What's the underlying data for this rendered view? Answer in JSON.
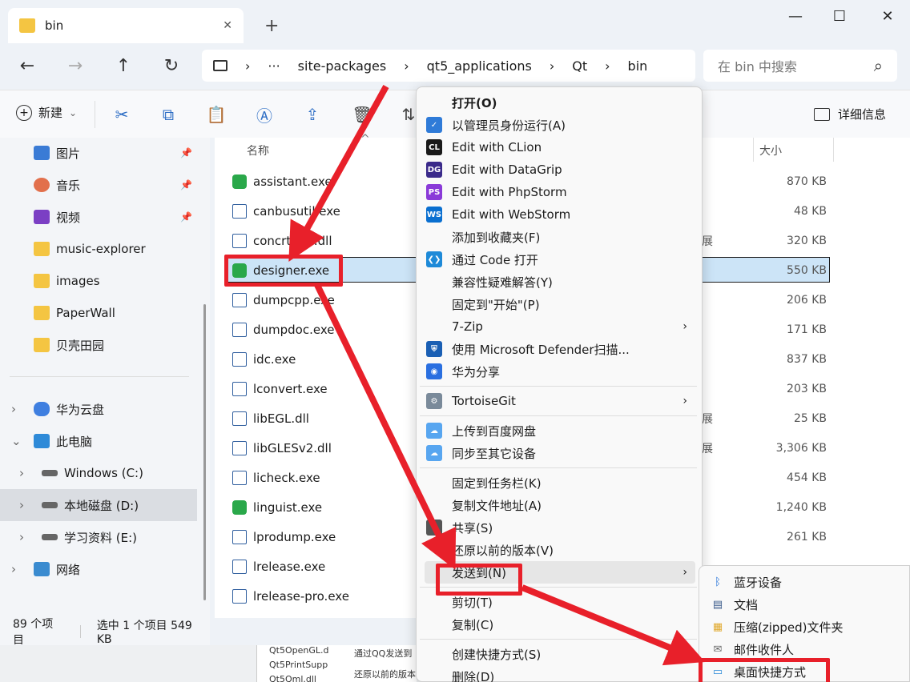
{
  "tab": {
    "title": "bin",
    "close": "✕",
    "new": "+"
  },
  "window": {
    "min": "—",
    "max": "☐",
    "close": "✕"
  },
  "nav_buttons": {
    "back": "←",
    "forward": "→",
    "up": "↑",
    "refresh": "↻"
  },
  "address": {
    "more": "···",
    "sep": "›",
    "crumbs": [
      "site-packages",
      "qt5_applications",
      "Qt",
      "bin"
    ]
  },
  "search": {
    "placeholder": "在 bin 中搜索",
    "icon": "⌕"
  },
  "toolbar": {
    "new_label": "新建",
    "new_arrow": "⌄",
    "details_label": "详细信息"
  },
  "sidebar": {
    "quick": [
      {
        "label": "图片",
        "icon": "pictures-icon",
        "pinned": true
      },
      {
        "label": "音乐",
        "icon": "music-icon",
        "pinned": true
      },
      {
        "label": "视频",
        "icon": "video-icon",
        "pinned": true
      },
      {
        "label": "music-explorer",
        "icon": "folder-icon"
      },
      {
        "label": "images",
        "icon": "folder-icon"
      },
      {
        "label": "PaperWall",
        "icon": "folder-icon"
      },
      {
        "label": "贝壳田园",
        "icon": "folder-icon"
      }
    ],
    "tree": [
      {
        "label": "华为云盘",
        "icon": "cloud-icon",
        "chev": "›"
      },
      {
        "label": "此电脑",
        "icon": "pc-icon",
        "chev": "⌄"
      },
      {
        "label": "Windows (C:)",
        "icon": "drive-icon",
        "chev": "›"
      },
      {
        "label": "本地磁盘 (D:)",
        "icon": "drive-icon",
        "chev": "›"
      },
      {
        "label": "学习资料 (E:)",
        "icon": "drive-icon",
        "chev": "›"
      },
      {
        "label": "网络",
        "icon": "network-icon",
        "chev": "›"
      }
    ]
  },
  "columns": {
    "name": "名称",
    "size": "大小"
  },
  "files": [
    {
      "name": "assistant.exe",
      "size": "870 KB",
      "type": "",
      "color": "#2aa84a"
    },
    {
      "name": "canbusutil.exe",
      "size": "48 KB",
      "type": "",
      "color": ""
    },
    {
      "name": "concrt140.dll",
      "size": "320 KB",
      "type": "展",
      "color": ""
    },
    {
      "name": "designer.exe",
      "size": "550 KB",
      "type": "",
      "color": "#2aa84a"
    },
    {
      "name": "dumpcpp.exe",
      "size": "206 KB",
      "type": "",
      "color": ""
    },
    {
      "name": "dumpdoc.exe",
      "size": "171 KB",
      "type": "",
      "color": ""
    },
    {
      "name": "idc.exe",
      "size": "837 KB",
      "type": "",
      "color": ""
    },
    {
      "name": "lconvert.exe",
      "size": "203 KB",
      "type": "",
      "color": ""
    },
    {
      "name": "libEGL.dll",
      "size": "25 KB",
      "type": "展",
      "color": ""
    },
    {
      "name": "libGLESv2.dll",
      "size": "3,306 KB",
      "type": "展",
      "color": ""
    },
    {
      "name": "licheck.exe",
      "size": "454 KB",
      "type": "",
      "color": ""
    },
    {
      "name": "linguist.exe",
      "size": "1,240 KB",
      "type": "",
      "color": "#2aa84a"
    },
    {
      "name": "lprodump.exe",
      "size": "261 KB",
      "type": "",
      "color": ""
    },
    {
      "name": "lrelease.exe",
      "size": "",
      "type": "",
      "color": ""
    },
    {
      "name": "lrelease-pro.exe",
      "size": "",
      "type": "",
      "color": ""
    }
  ],
  "status": {
    "count": "89 个项目",
    "selected": "选中 1 个项目  549 KB"
  },
  "bottom_files": [
    "Qt5OpenGL.d",
    "Qt5PrintSupp",
    "Qt5Qml.dll",
    "通过QQ发送到",
    "还原以前的版本"
  ],
  "menu": {
    "items": [
      {
        "label": "打开(O)",
        "icon": "",
        "bold": true,
        "arrow": ""
      },
      {
        "label": "以管理员身份运行(A)",
        "icon": "shield-icon",
        "arrow": ""
      },
      {
        "label": "Edit with CLion",
        "icon": "clion-icon",
        "arrow": ""
      },
      {
        "label": "Edit with DataGrip",
        "icon": "datagrip-icon",
        "arrow": ""
      },
      {
        "label": "Edit with PhpStorm",
        "icon": "phpstorm-icon",
        "arrow": ""
      },
      {
        "label": "Edit with WebStorm",
        "icon": "webstorm-icon",
        "arrow": ""
      },
      {
        "label": "添加到收藏夹(F)",
        "icon": "",
        "arrow": ""
      },
      {
        "label": "通过 Code 打开",
        "icon": "vscode-icon",
        "arrow": ""
      },
      {
        "label": "兼容性疑难解答(Y)",
        "icon": "",
        "arrow": ""
      },
      {
        "label": "固定到\"开始\"(P)",
        "icon": "",
        "arrow": ""
      },
      {
        "label": "7-Zip",
        "icon": "",
        "arrow": "›"
      },
      {
        "label": "使用 Microsoft Defender扫描...",
        "icon": "defender-icon",
        "arrow": ""
      },
      {
        "label": "华为分享",
        "icon": "huawei-share-icon",
        "arrow": ""
      },
      {
        "label": "TortoiseGit",
        "icon": "tortoisegit-icon",
        "arrow": "›"
      },
      {
        "label": "上传到百度网盘",
        "icon": "baidu-icon",
        "arrow": ""
      },
      {
        "label": "同步至其它设备",
        "icon": "baidu-icon",
        "arrow": ""
      },
      {
        "label": "固定到任务栏(K)",
        "icon": "",
        "arrow": ""
      },
      {
        "label": "复制文件地址(A)",
        "icon": "",
        "arrow": ""
      },
      {
        "label": "共享(S)",
        "icon": "share-icon",
        "arrow": ""
      },
      {
        "label": "还原以前的版本(V)",
        "icon": "",
        "arrow": ""
      },
      {
        "label": "发送到(N)",
        "icon": "",
        "arrow": "›"
      },
      {
        "label": "剪切(T)",
        "icon": "",
        "arrow": ""
      },
      {
        "label": "复制(C)",
        "icon": "",
        "arrow": ""
      },
      {
        "label": "创建快捷方式(S)",
        "icon": "",
        "arrow": ""
      },
      {
        "label": "删除(D)",
        "icon": "",
        "arrow": ""
      }
    ]
  },
  "submenu": {
    "items": [
      {
        "label": "蓝牙设备",
        "icon": "bluetooth-icon"
      },
      {
        "label": "文档",
        "icon": "document-icon"
      },
      {
        "label": "压缩(zipped)文件夹",
        "icon": "zip-icon"
      },
      {
        "label": "邮件收件人",
        "icon": "mail-icon"
      },
      {
        "label": "桌面快捷方式",
        "icon": "desktop-icon"
      }
    ]
  },
  "colors": {
    "annotation": "#e8202a",
    "selection": "#cce4f7"
  }
}
